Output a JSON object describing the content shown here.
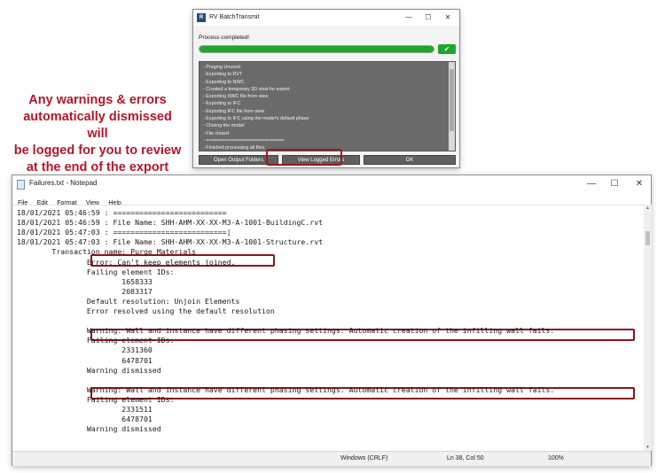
{
  "annotation": {
    "lines": [
      "Any warnings & errors",
      "automatically dismissed will",
      "be logged for you to review",
      "at the end of the export"
    ]
  },
  "batch_window": {
    "title": "RV BatchTransmit",
    "app_icon_letter": "R",
    "status_text": "Process completed!",
    "progress": 1.0,
    "log_lines": [
      "- Purging Unused",
      "- Exporting to RVT",
      "- Exporting to NWC",
      "- Created a temporary 3D view for export",
      "- Exporting NWC file from view",
      "- Exporting to IFC",
      "- Exporting IFC file from view",
      "- Exporting to IFC using the model's default phase",
      "- Closing the model",
      "- File closed",
      "- ============================",
      "- Finished processing all files"
    ],
    "buttons": {
      "open_output": "Open Output Folders",
      "view_errors": "View Logged Errors",
      "ok": "OK"
    },
    "icons": {
      "minimize": "minimize-icon",
      "maximize": "maximize-icon",
      "close": "close-icon",
      "check": "check-icon"
    },
    "colors": {
      "progress": "#1ea52e",
      "log_bg": "#6b6b6b"
    }
  },
  "notepad": {
    "title": "Failures.txt - Notepad",
    "menu": [
      "File",
      "Edit",
      "Format",
      "View",
      "Help"
    ],
    "lines": [
      "18/01/2021 05:46:59 : ==========================",
      "18/01/2021 05:46:59 : File Name: SHH-AHM-XX-XX-M3-A-1001-BuildingC.rvt",
      "18/01/2021 05:47:03 : ==========================|",
      "18/01/2021 05:47:03 : File Name: SHH-AHM-XX-XX-M3-A-1001-Structure.rvt",
      "        Transaction name: Purge Materials",
      "                Error: Can't keep elements joined.",
      "                Failing element IDs:",
      "                        1658333",
      "                        2083317",
      "                Default resolution: Unjoin Elements",
      "                Error resolved using the default resolution",
      "",
      "                Warning: Wall and instance have different phasing settings. Automatic creation of the infilling wall fails.",
      "                Failing element IDs:",
      "                        2331360",
      "                        6478701",
      "                Warning dismissed",
      "",
      "                Warning: Wall and instance have different phasing settings. Automatic creation of the infilling wall fails.",
      "                Failing element IDs:",
      "                        2331511",
      "                        6478701",
      "                Warning dismissed"
    ],
    "status": {
      "encoding": "Windows (CRLF)",
      "position": "Ln 38, Col 50",
      "zoom": "100%"
    },
    "colors": {
      "highlight": "#8c1420",
      "annotation": "#b3162b"
    }
  }
}
